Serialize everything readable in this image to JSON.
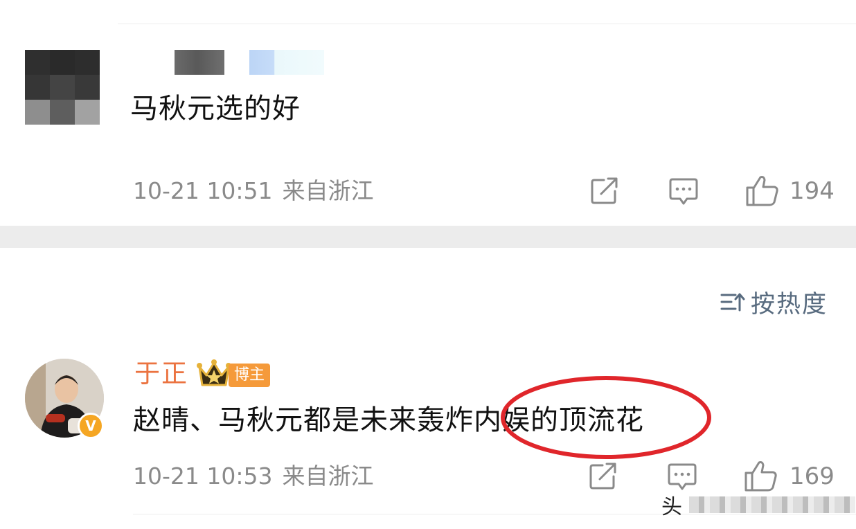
{
  "comments": [
    {
      "text": "马秋元选的好",
      "time": "10-21 10:51",
      "location": "来自浙江",
      "likes": "194",
      "icons": [
        "share-icon",
        "comment-icon",
        "thumbs-up-icon"
      ]
    },
    {
      "author": "于正",
      "badge": "博主",
      "verified_mark": "V",
      "text": "赵晴、马秋元都是未来轰炸内娱的顶流花",
      "time": "10-21 10:53",
      "location": "来自浙江",
      "likes": "169",
      "icons": [
        "share-icon",
        "comment-icon",
        "thumbs-up-icon"
      ]
    }
  ],
  "sort": {
    "label": "按热度",
    "icon": "sort-icon"
  },
  "watermark": {
    "visible_char": "头"
  },
  "colors": {
    "username": "#eb7340",
    "badge_bg": "#f59a3a",
    "meta": "#8a8a8a",
    "sort": "#586b7f",
    "highlight_circle": "#e0262b",
    "separator_band": "#ececec"
  }
}
